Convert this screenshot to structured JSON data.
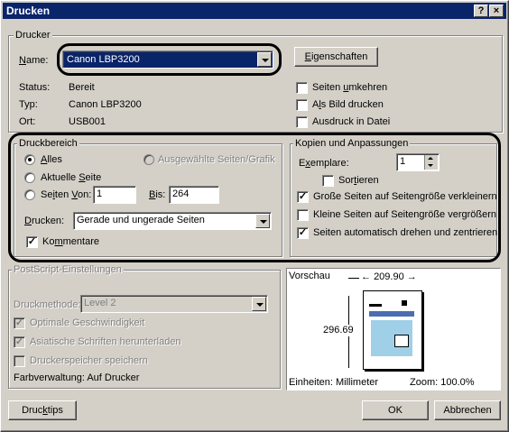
{
  "window": {
    "title": "Drucken",
    "help_btn": "?",
    "close_btn": "×"
  },
  "printer": {
    "group": "Drucker",
    "name_label": "Name:",
    "name_value": "Canon LBP3200",
    "properties_btn": "Eigenschaften",
    "status_label": "Status:",
    "status_value": "Bereit",
    "type_label": "Typ:",
    "type_value": "Canon LBP3200",
    "location_label": "Ort:",
    "location_value": "USB001",
    "reverse_pages": "Seiten umkehren",
    "print_as_image": "Als Bild drucken",
    "print_to_file": "Ausdruck in Datei"
  },
  "range": {
    "group": "Druckbereich",
    "all": "Alles",
    "selection": "Ausgewählte Seiten/Grafik",
    "current": "Aktuelle Seite",
    "pages": "Seiten",
    "from_label": "Von:",
    "from_value": "1",
    "to_label": "Bis:",
    "to_value": "264",
    "print_label": "Drucken:",
    "print_value": "Gerade und ungerade Seiten",
    "comments": "Kommentare"
  },
  "copies": {
    "group": "Kopien und Anpassungen",
    "copies_label": "Exemplare:",
    "copies_value": "1",
    "collate": "Sortieren",
    "shrink": "Große Seiten auf Seitengröße verkleinern",
    "expand": "Kleine Seiten auf Seitengröße vergrößern",
    "autorotate": "Seiten automatisch drehen und zentrieren"
  },
  "postscript": {
    "group": "PostScript-Einstellungen",
    "method_label": "Druckmethode:",
    "method_value": "Level 2",
    "optimize_speed": "Optimale Geschwindigkeit",
    "asian_fonts": "Asiatische Schriften herunterladen",
    "save_memory": "Druckerspeicher speichern",
    "color_mgmt": "Farbverwaltung:  Auf Drucker"
  },
  "preview": {
    "label": "Vorschau",
    "width": "209.90",
    "height": "296.69",
    "units": "Einheiten: Millimeter",
    "zoom": "Zoom: 100.0%"
  },
  "footer": {
    "tips_btn": "Drucktips",
    "ok_btn": "OK",
    "cancel_btn": "Abbrechen"
  }
}
